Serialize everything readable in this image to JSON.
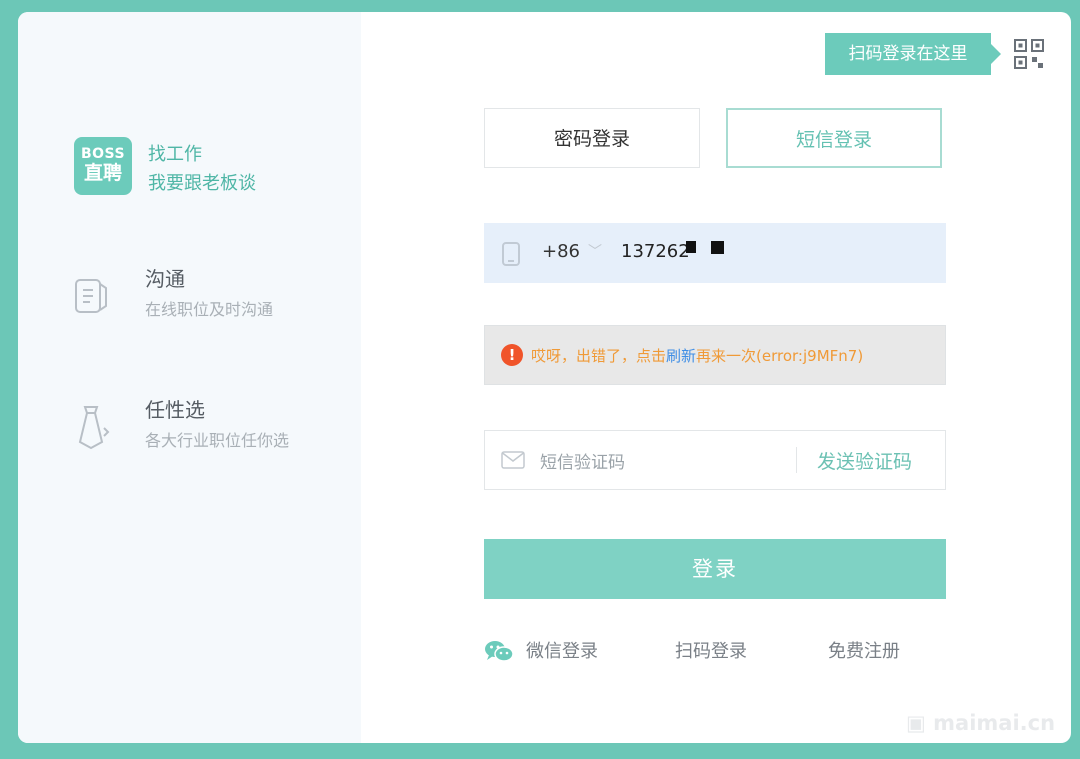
{
  "left": {
    "logo": {
      "line1": "BOSS",
      "line2": "直聘"
    },
    "tagline": {
      "line1": "找工作",
      "line2": "我要跟老板谈"
    },
    "features": [
      {
        "title": "沟通",
        "subtitle": "在线职位及时沟通"
      },
      {
        "title": "任性选",
        "subtitle": "各大行业职位任你选"
      }
    ]
  },
  "qr_tip": "扫码登录在这里",
  "tabs": [
    {
      "label": "密码登录",
      "active": false
    },
    {
      "label": "短信登录",
      "active": true
    }
  ],
  "phone": {
    "country_code": "+86",
    "number": "137262"
  },
  "error": {
    "prefix": "哎呀，出错了，点击",
    "link": "刷新",
    "suffix": "再来一次(error:j9MFn7)"
  },
  "sms": {
    "placeholder": "短信验证码",
    "send_label": "发送验证码"
  },
  "login_button": "登录",
  "bottom_links": {
    "wechat": "微信登录",
    "scan": "扫码登录",
    "register": "免费注册"
  },
  "watermark": "maimai.cn",
  "colors": {
    "accent": "#6ccbbb",
    "error": "#f0542a",
    "link": "#3f8ee5",
    "background": "#6cc7b7"
  }
}
